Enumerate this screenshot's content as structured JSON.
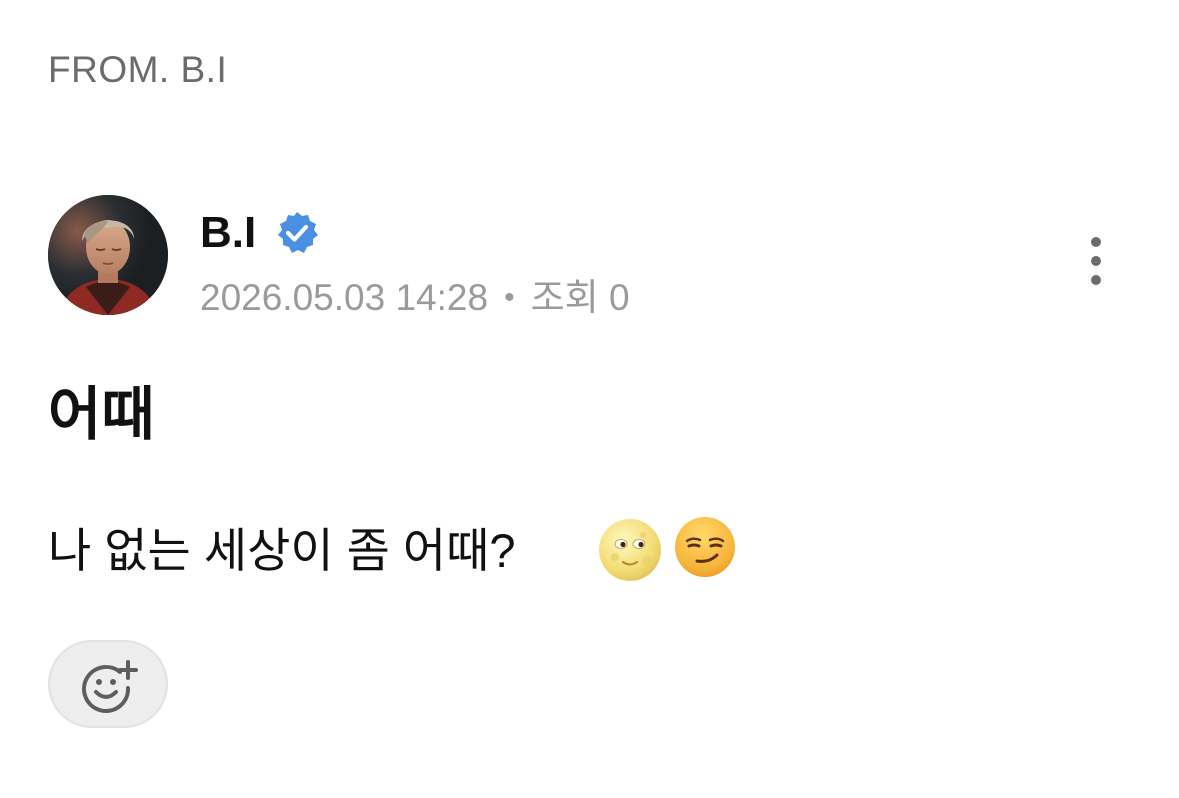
{
  "header": {
    "from_label": "FROM. B.I"
  },
  "post": {
    "author": {
      "name": "B.I",
      "verified": true,
      "badge_color": "#4a90e2"
    },
    "timestamp": "2026.05.03 14:28",
    "separator": "•",
    "views_label": "조회 0",
    "title": "어때",
    "body": "나 없는 세상이 좀 어때?",
    "emojis": [
      "full-moon-face",
      "smirking-face"
    ],
    "actions": {
      "more_icon": "more-vertical-icon",
      "reaction_icon": "add-reaction-icon"
    }
  }
}
